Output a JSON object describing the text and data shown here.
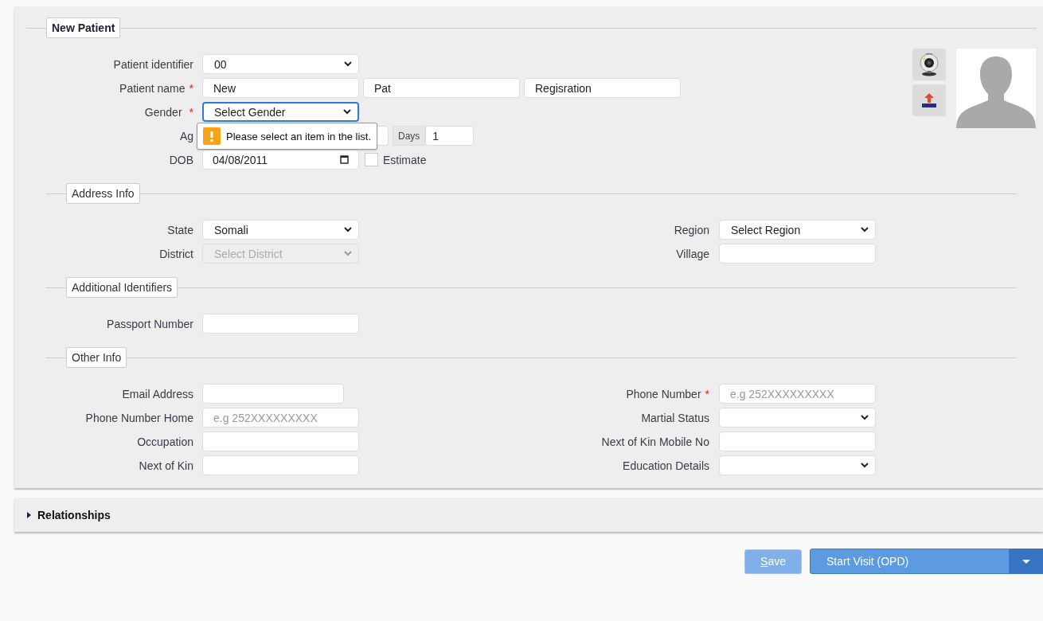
{
  "panel": {
    "legend": "New Patient"
  },
  "patient": {
    "identifier": {
      "label": "Patient identifier",
      "value": "00"
    },
    "name": {
      "label": "Patient name",
      "required_mark": "*",
      "values": [
        "New",
        "Pat",
        "Regisration"
      ]
    },
    "gender": {
      "label": "Gender",
      "required_mark": "*",
      "value": "Select Gender",
      "focused": true
    },
    "age": {
      "label": "Ag",
      "unit": "Days",
      "value": "1"
    },
    "dob": {
      "label": "DOB",
      "value": "04/08/2011",
      "estimate_label": "Estimate",
      "estimate_checked": false
    }
  },
  "validation_tooltip": {
    "text": "Please select an item in the list."
  },
  "sections": [
    {
      "legend": "Address Info",
      "rows": [
        {
          "left": {
            "label": "State",
            "kind": "select",
            "value": "Somali",
            "disabled": false
          },
          "right": {
            "label": "Region",
            "kind": "select",
            "value": "Select Region",
            "disabled": false
          }
        },
        {
          "left": {
            "label": "District",
            "kind": "select",
            "value": "Select District",
            "disabled": true
          },
          "right": {
            "label": "Village",
            "kind": "input"
          }
        }
      ]
    },
    {
      "legend": "Additional Identifiers",
      "rows": [
        {
          "left": {
            "label": "Passport Number",
            "kind": "input"
          }
        }
      ]
    },
    {
      "legend": "Other Info",
      "rows": [
        {
          "left": {
            "label": "Email Address",
            "kind": "input",
            "narrow": true
          },
          "right": {
            "label": "Phone Number",
            "kind": "input",
            "placeholder": "e.g 252XXXXXXXXX",
            "required_mark": "*"
          }
        },
        {
          "left": {
            "label": "Phone Number Home",
            "kind": "input",
            "placeholder": "e.g 252XXXXXXXXX"
          },
          "right": {
            "label": "Martial Status",
            "kind": "select",
            "disabled": false
          }
        },
        {
          "left": {
            "label": "Occupation",
            "kind": "input"
          },
          "right": {
            "label": "Next of Kin Mobile No",
            "kind": "input"
          }
        },
        {
          "left": {
            "label": "Next of Kin",
            "kind": "input"
          },
          "right": {
            "label": "Education Details",
            "kind": "select",
            "disabled": false
          }
        }
      ]
    }
  ],
  "relationships": {
    "title": "Relationships",
    "expanded": false
  },
  "buttons": {
    "save": {
      "label": "Save",
      "disabled": true
    },
    "start_visit": {
      "label": "Start Visit (OPD)"
    }
  }
}
